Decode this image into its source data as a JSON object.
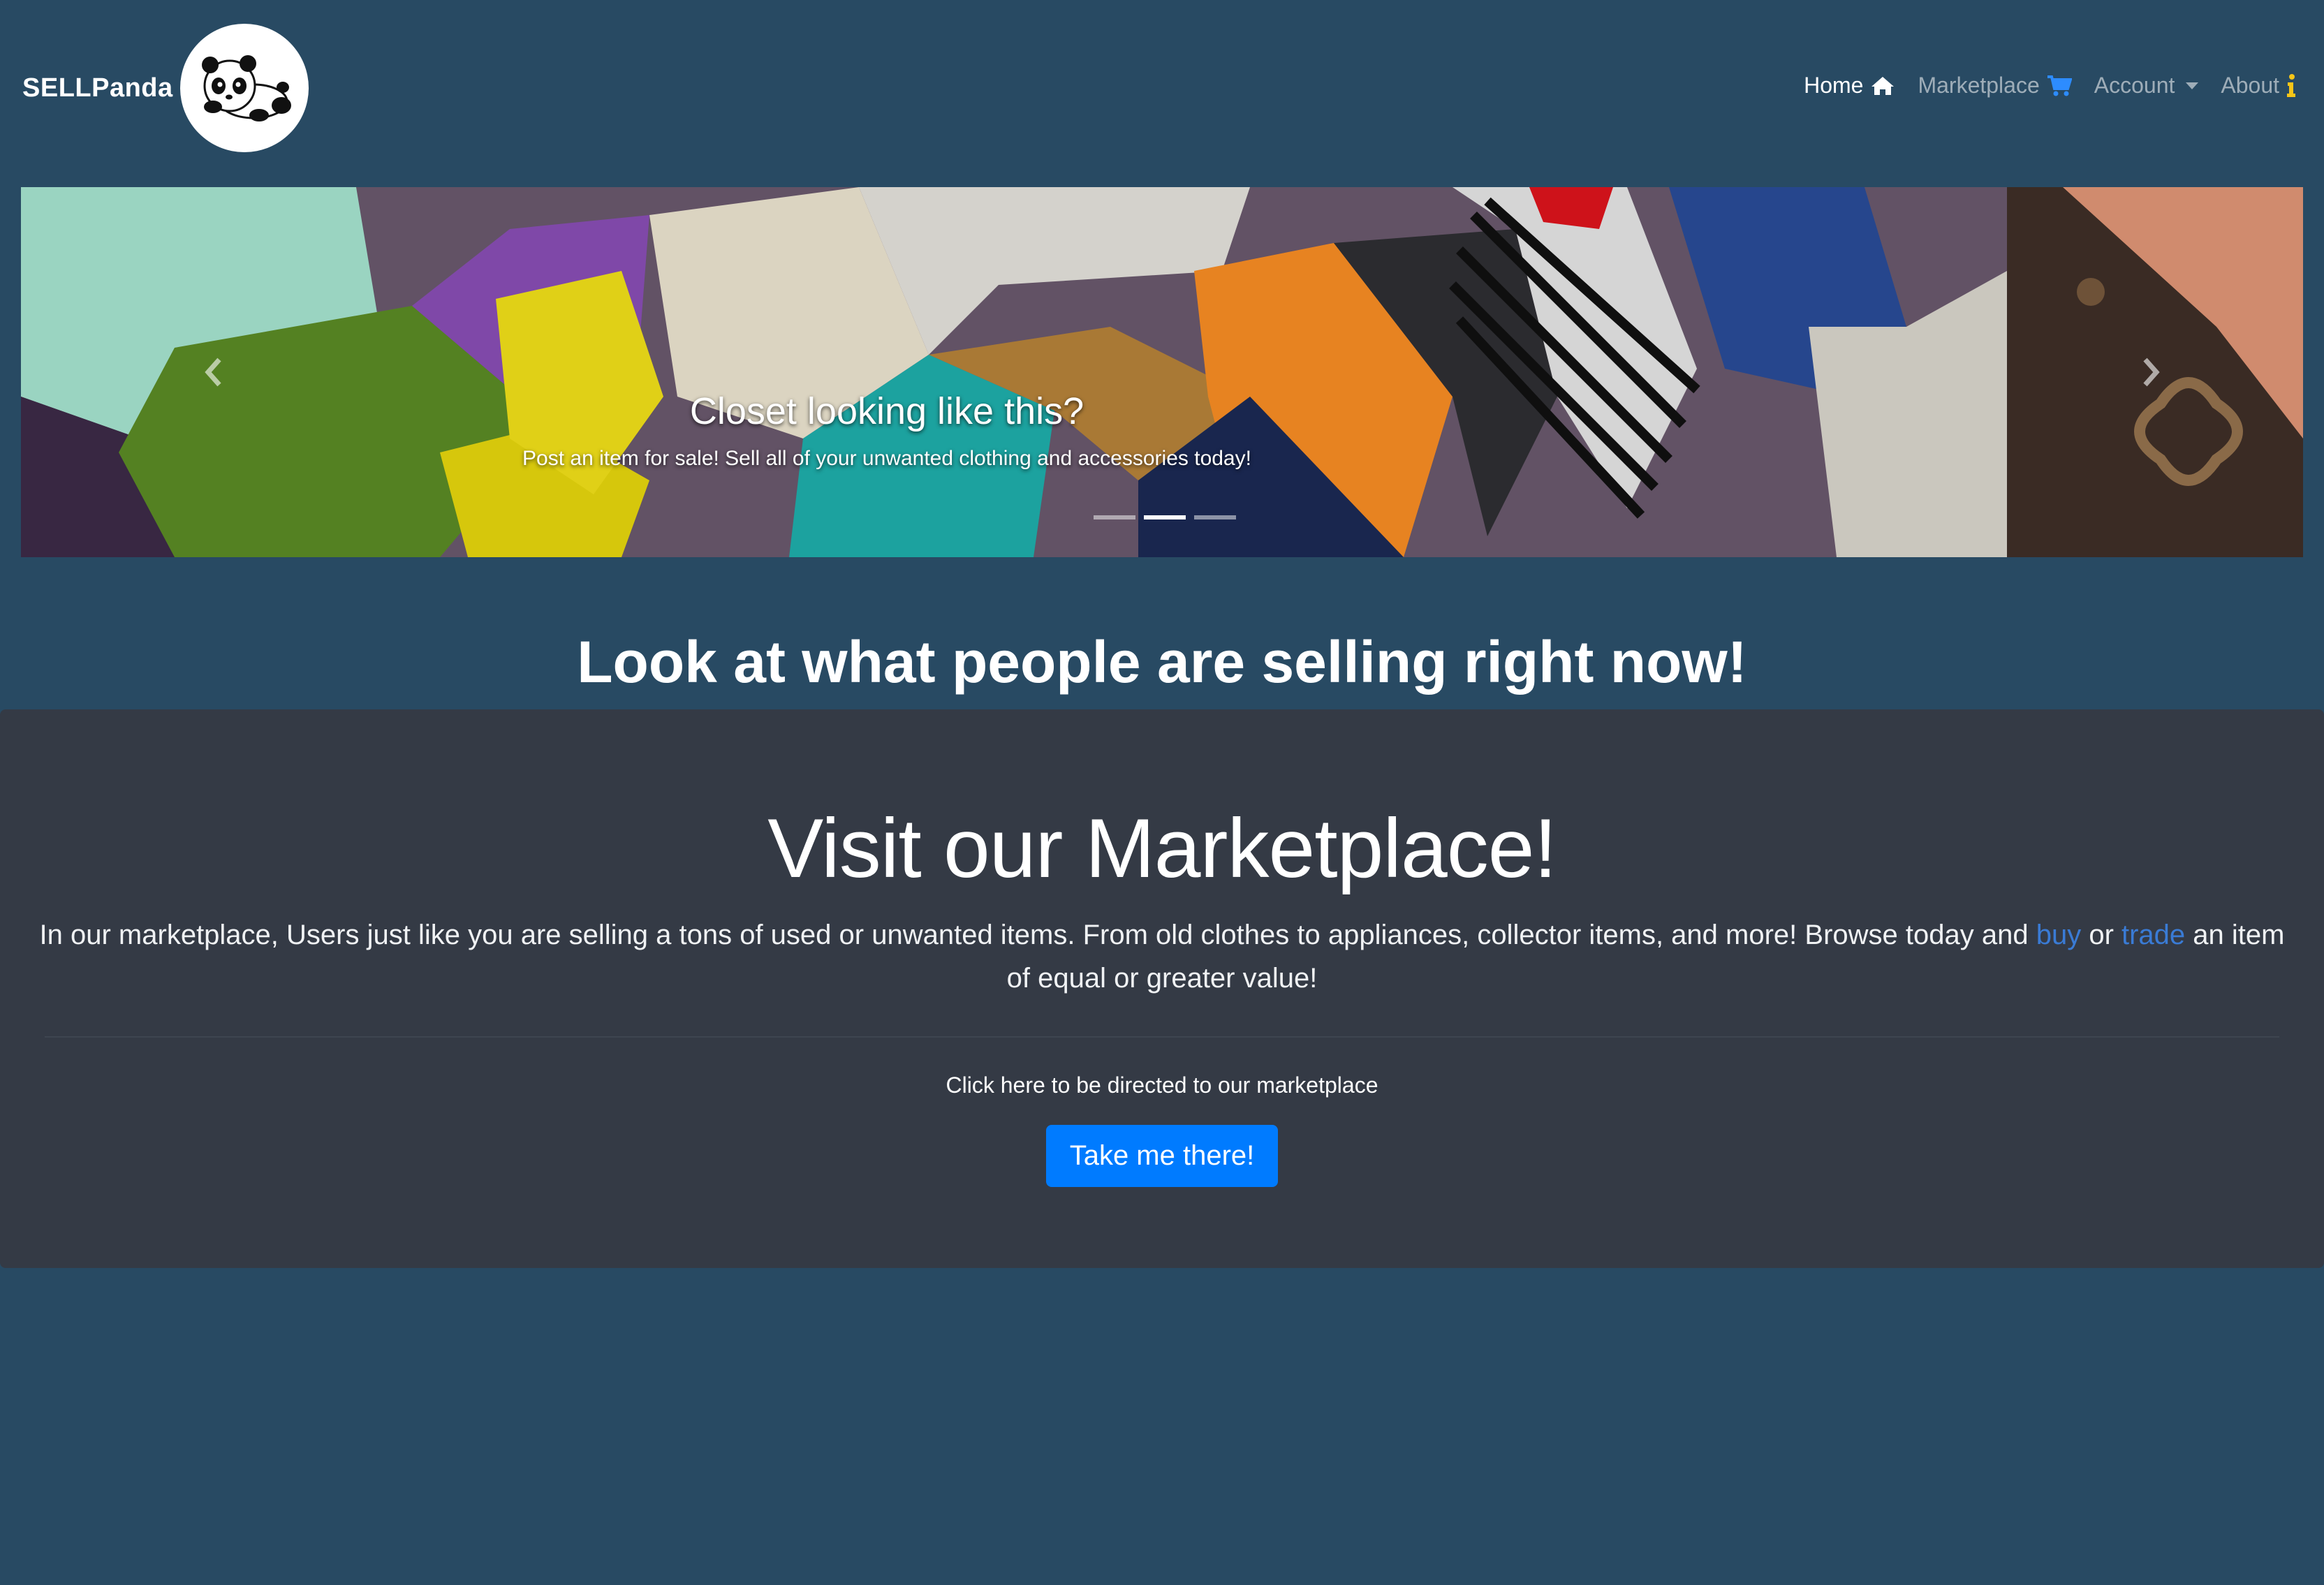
{
  "navbar": {
    "brand": "SELLPanda",
    "items": [
      {
        "label": "Home",
        "icon": "home-icon",
        "active": true
      },
      {
        "label": "Marketplace",
        "icon": "cart-icon",
        "active": false
      },
      {
        "label": "Account",
        "icon": "caret-down-icon",
        "active": false
      },
      {
        "label": "About",
        "icon": "info-icon",
        "active": false
      }
    ],
    "colors": {
      "cart_icon": "#2d8cff",
      "info_icon": "#f5c518"
    }
  },
  "carousel": {
    "caption_title": "Closet looking like this?",
    "caption_text": "Post an item for sale! Sell all of your unwanted clothing and accessories today!",
    "slides": 3,
    "active_slide": 2
  },
  "headline": "Look at what people are selling right now!",
  "jumbotron": {
    "title": "Visit our Marketplace!",
    "lead_before": "In our marketplace, Users just like you are selling a tons of used or unwanted items. From old clothes to appliances, collector items, and more! Browse today and ",
    "link_buy": "buy",
    "lead_or": " or ",
    "link_trade": "trade",
    "lead_after": " an item of equal or greater value!",
    "cta_text": "Click here to be directed to our marketplace",
    "button_label": "Take me there!"
  },
  "colors": {
    "background": "#284a63",
    "jumbotron": "#343a45",
    "primary": "#007bff",
    "link": "#3a7bd5"
  }
}
